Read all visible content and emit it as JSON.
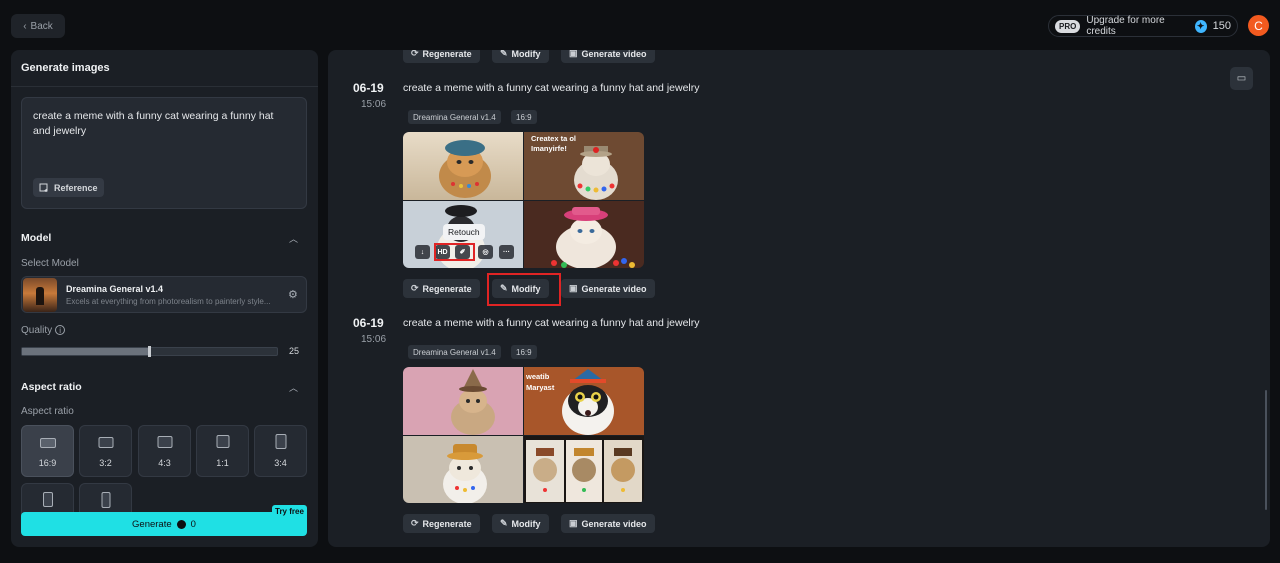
{
  "topbar": {
    "back_label": "Back",
    "pro_badge": "PRO",
    "upgrade_text": "Upgrade for more credits",
    "credits": "150",
    "avatar_letter": "C"
  },
  "left": {
    "title": "Generate images",
    "prompt": "create a meme with a funny cat wearing a funny hat and jewelry",
    "reference_label": "Reference",
    "model_section": "Model",
    "select_model_label": "Select Model",
    "model_name": "Dreamina General v1.4",
    "model_desc": "Excels at everything from photorealism to painterly style...",
    "quality_label": "Quality",
    "quality_value": "25",
    "quality_fraction": 0.5,
    "aspect_section": "Aspect ratio",
    "aspect_label": "Aspect ratio",
    "ratios": [
      "16:9",
      "3:2",
      "4:3",
      "1:1",
      "3:4"
    ],
    "selected_ratio": "16:9",
    "generate_label": "Generate",
    "generate_cost": "0",
    "try_free": "Try free"
  },
  "actions": {
    "regenerate": "Regenerate",
    "modify": "Modify",
    "generate_video": "Generate video"
  },
  "generations": [
    {
      "date": "06-19",
      "time": "15:06",
      "prompt": "create a meme with a funny cat wearing a funny hat and jewelry",
      "model_tag": "Dreamina General v1.4",
      "ratio_tag": "16:9",
      "image_caption": "Createx ta ol Imanyirfe!"
    },
    {
      "date": "06-19",
      "time": "15:06",
      "prompt": "create a meme with a funny cat wearing a funny hat and jewelry",
      "model_tag": "Dreamina General v1.4",
      "ratio_tag": "16:9",
      "image_caption": "weatib Maryast"
    }
  ],
  "hover_tools": {
    "hd_label": "HD",
    "more_label": "···",
    "tooltip": "Retouch"
  },
  "colors": {
    "accent": "#1fe0e4",
    "highlight": "#e02424",
    "avatar": "#f25a1f"
  }
}
